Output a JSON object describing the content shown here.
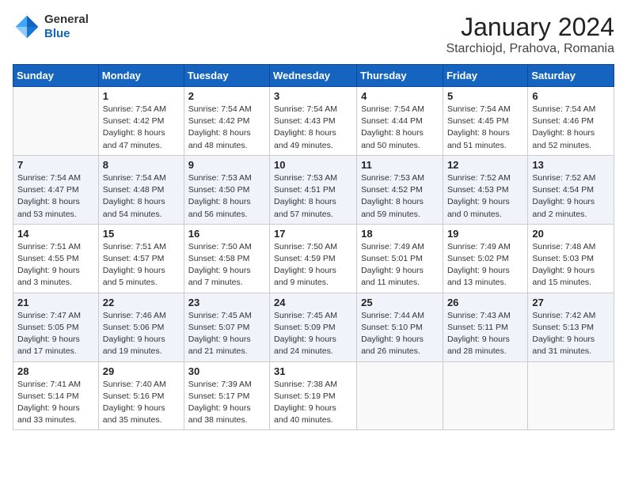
{
  "header": {
    "logo_general": "General",
    "logo_blue": "Blue",
    "title": "January 2024",
    "subtitle": "Starchiojd, Prahova, Romania"
  },
  "columns": [
    "Sunday",
    "Monday",
    "Tuesday",
    "Wednesday",
    "Thursday",
    "Friday",
    "Saturday"
  ],
  "weeks": [
    [
      {
        "num": "",
        "info": ""
      },
      {
        "num": "1",
        "info": "Sunrise: 7:54 AM\nSunset: 4:42 PM\nDaylight: 8 hours\nand 47 minutes."
      },
      {
        "num": "2",
        "info": "Sunrise: 7:54 AM\nSunset: 4:42 PM\nDaylight: 8 hours\nand 48 minutes."
      },
      {
        "num": "3",
        "info": "Sunrise: 7:54 AM\nSunset: 4:43 PM\nDaylight: 8 hours\nand 49 minutes."
      },
      {
        "num": "4",
        "info": "Sunrise: 7:54 AM\nSunset: 4:44 PM\nDaylight: 8 hours\nand 50 minutes."
      },
      {
        "num": "5",
        "info": "Sunrise: 7:54 AM\nSunset: 4:45 PM\nDaylight: 8 hours\nand 51 minutes."
      },
      {
        "num": "6",
        "info": "Sunrise: 7:54 AM\nSunset: 4:46 PM\nDaylight: 8 hours\nand 52 minutes."
      }
    ],
    [
      {
        "num": "7",
        "info": "Sunrise: 7:54 AM\nSunset: 4:47 PM\nDaylight: 8 hours\nand 53 minutes."
      },
      {
        "num": "8",
        "info": "Sunrise: 7:54 AM\nSunset: 4:48 PM\nDaylight: 8 hours\nand 54 minutes."
      },
      {
        "num": "9",
        "info": "Sunrise: 7:53 AM\nSunset: 4:50 PM\nDaylight: 8 hours\nand 56 minutes."
      },
      {
        "num": "10",
        "info": "Sunrise: 7:53 AM\nSunset: 4:51 PM\nDaylight: 8 hours\nand 57 minutes."
      },
      {
        "num": "11",
        "info": "Sunrise: 7:53 AM\nSunset: 4:52 PM\nDaylight: 8 hours\nand 59 minutes."
      },
      {
        "num": "12",
        "info": "Sunrise: 7:52 AM\nSunset: 4:53 PM\nDaylight: 9 hours\nand 0 minutes."
      },
      {
        "num": "13",
        "info": "Sunrise: 7:52 AM\nSunset: 4:54 PM\nDaylight: 9 hours\nand 2 minutes."
      }
    ],
    [
      {
        "num": "14",
        "info": "Sunrise: 7:51 AM\nSunset: 4:55 PM\nDaylight: 9 hours\nand 3 minutes."
      },
      {
        "num": "15",
        "info": "Sunrise: 7:51 AM\nSunset: 4:57 PM\nDaylight: 9 hours\nand 5 minutes."
      },
      {
        "num": "16",
        "info": "Sunrise: 7:50 AM\nSunset: 4:58 PM\nDaylight: 9 hours\nand 7 minutes."
      },
      {
        "num": "17",
        "info": "Sunrise: 7:50 AM\nSunset: 4:59 PM\nDaylight: 9 hours\nand 9 minutes."
      },
      {
        "num": "18",
        "info": "Sunrise: 7:49 AM\nSunset: 5:01 PM\nDaylight: 9 hours\nand 11 minutes."
      },
      {
        "num": "19",
        "info": "Sunrise: 7:49 AM\nSunset: 5:02 PM\nDaylight: 9 hours\nand 13 minutes."
      },
      {
        "num": "20",
        "info": "Sunrise: 7:48 AM\nSunset: 5:03 PM\nDaylight: 9 hours\nand 15 minutes."
      }
    ],
    [
      {
        "num": "21",
        "info": "Sunrise: 7:47 AM\nSunset: 5:05 PM\nDaylight: 9 hours\nand 17 minutes."
      },
      {
        "num": "22",
        "info": "Sunrise: 7:46 AM\nSunset: 5:06 PM\nDaylight: 9 hours\nand 19 minutes."
      },
      {
        "num": "23",
        "info": "Sunrise: 7:45 AM\nSunset: 5:07 PM\nDaylight: 9 hours\nand 21 minutes."
      },
      {
        "num": "24",
        "info": "Sunrise: 7:45 AM\nSunset: 5:09 PM\nDaylight: 9 hours\nand 24 minutes."
      },
      {
        "num": "25",
        "info": "Sunrise: 7:44 AM\nSunset: 5:10 PM\nDaylight: 9 hours\nand 26 minutes."
      },
      {
        "num": "26",
        "info": "Sunrise: 7:43 AM\nSunset: 5:11 PM\nDaylight: 9 hours\nand 28 minutes."
      },
      {
        "num": "27",
        "info": "Sunrise: 7:42 AM\nSunset: 5:13 PM\nDaylight: 9 hours\nand 31 minutes."
      }
    ],
    [
      {
        "num": "28",
        "info": "Sunrise: 7:41 AM\nSunset: 5:14 PM\nDaylight: 9 hours\nand 33 minutes."
      },
      {
        "num": "29",
        "info": "Sunrise: 7:40 AM\nSunset: 5:16 PM\nDaylight: 9 hours\nand 35 minutes."
      },
      {
        "num": "30",
        "info": "Sunrise: 7:39 AM\nSunset: 5:17 PM\nDaylight: 9 hours\nand 38 minutes."
      },
      {
        "num": "31",
        "info": "Sunrise: 7:38 AM\nSunset: 5:19 PM\nDaylight: 9 hours\nand 40 minutes."
      },
      {
        "num": "",
        "info": ""
      },
      {
        "num": "",
        "info": ""
      },
      {
        "num": "",
        "info": ""
      }
    ]
  ]
}
